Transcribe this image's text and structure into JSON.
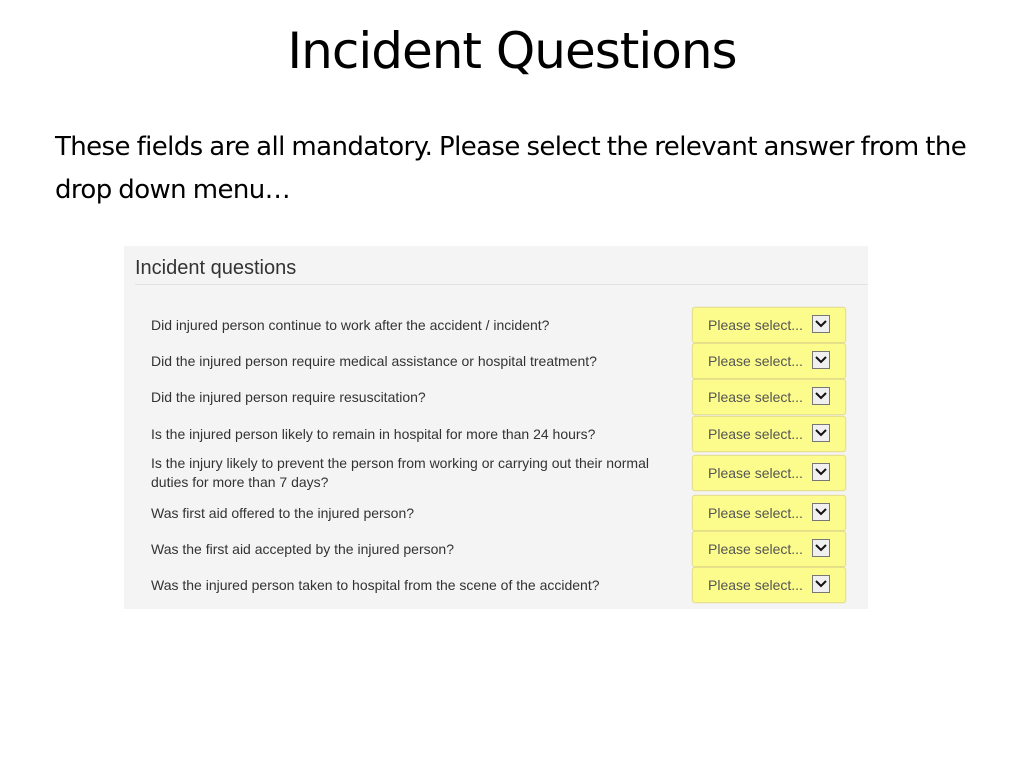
{
  "slide": {
    "title": "Incident Questions",
    "body": "These fields are all mandatory.  Please select the relevant answer from the drop down menu…"
  },
  "panel": {
    "header": "Incident questions",
    "questions": [
      {
        "label": "Did injured person continue to work after the accident / incident?",
        "value": "Please select..."
      },
      {
        "label": "Did the injured person require medical assistance or hospital treatment?",
        "value": "Please select..."
      },
      {
        "label": "Did the injured person require resuscitation?",
        "value": "Please select..."
      },
      {
        "label": "Is the injured person likely to remain in hospital for more than 24 hours?",
        "value": "Please select..."
      },
      {
        "label": "Is the injury likely to prevent the person from working or carrying out their normal duties for more than 7 days?",
        "value": "Please select..."
      },
      {
        "label": "Was first aid offered to the injured person?",
        "value": "Please select..."
      },
      {
        "label": "Was the first aid accepted by the injured person?",
        "value": "Please select..."
      },
      {
        "label": "Was the injured person taken to hospital from the scene of the accident?",
        "value": "Please select..."
      }
    ]
  },
  "colors": {
    "select_bg": "#fcfc8c",
    "panel_bg": "#f4f4f4"
  }
}
